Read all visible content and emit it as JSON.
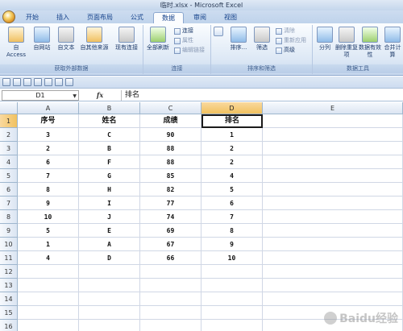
{
  "window": {
    "title": "临时.xlsx - Microsoft Excel"
  },
  "tabs": [
    "开始",
    "插入",
    "页面布局",
    "公式",
    "数据",
    "审阅",
    "视图"
  ],
  "active_tab": "数据",
  "ribbon": {
    "groups": [
      {
        "label": "获取外部数据",
        "buttons": [
          "自 Access",
          "自网站",
          "自文本",
          "自其他来源",
          "现有连接"
        ]
      },
      {
        "label": "连接",
        "buttons": [
          "全部刷新"
        ],
        "small": [
          "连接",
          "属性",
          "编辑链接"
        ]
      },
      {
        "label": "排序和筛选",
        "buttons": [
          "排序...",
          "筛选"
        ],
        "small": [
          "清除",
          "重新应用",
          "高级"
        ]
      },
      {
        "label": "数据工具",
        "buttons": [
          "分列",
          "删除重复项",
          "数据有效性",
          "合并计算"
        ]
      }
    ]
  },
  "formula_bar": {
    "name_box": "D1",
    "fx": "fx",
    "content": "排名"
  },
  "columns": [
    "A",
    "B",
    "C",
    "D",
    "E"
  ],
  "rows": [
    "1",
    "2",
    "3",
    "4",
    "5",
    "6",
    "7",
    "8",
    "9",
    "10",
    "11",
    "12",
    "13",
    "14",
    "15",
    "16"
  ],
  "table": {
    "headers": [
      "序号",
      "姓名",
      "成绩",
      "排名"
    ],
    "data": [
      [
        "3",
        "C",
        "90",
        "1"
      ],
      [
        "2",
        "B",
        "88",
        "2"
      ],
      [
        "6",
        "F",
        "88",
        "2"
      ],
      [
        "7",
        "G",
        "85",
        "4"
      ],
      [
        "8",
        "H",
        "82",
        "5"
      ],
      [
        "9",
        "I",
        "77",
        "6"
      ],
      [
        "10",
        "J",
        "74",
        "7"
      ],
      [
        "5",
        "E",
        "69",
        "8"
      ],
      [
        "1",
        "A",
        "67",
        "9"
      ],
      [
        "4",
        "D",
        "66",
        "10"
      ]
    ]
  },
  "active_cell": "D1",
  "watermark": "Baidu经验"
}
